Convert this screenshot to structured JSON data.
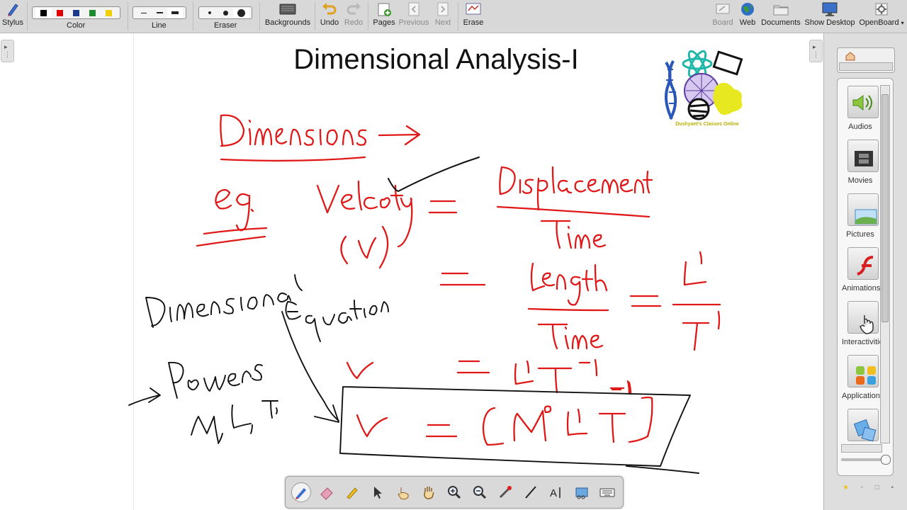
{
  "toolbar": {
    "stylus": "Stylus",
    "color": "Color",
    "line": "Line",
    "eraser": "Eraser",
    "backgrounds": "Backgrounds",
    "undo": "Undo",
    "redo": "Redo",
    "pages": "Pages",
    "previous": "Previous",
    "next": "Next",
    "erase": "Erase",
    "board": "Board",
    "web": "Web",
    "documents": "Documents",
    "show_desktop": "Show Desktop",
    "openboard": "OpenBoard"
  },
  "colors": {
    "swatches": [
      "#000000",
      "#e00000",
      "#1a3b8c",
      "#1e8a2e",
      "#f0d000"
    ],
    "ink_red": "#e01818",
    "ink_black": "#111111"
  },
  "board": {
    "title": "Dimensional Analysis-I",
    "logo_caption": "Dushyant's Classes Online"
  },
  "library": {
    "items": [
      {
        "label": "Audios"
      },
      {
        "label": "Movies"
      },
      {
        "label": "Pictures"
      },
      {
        "label": "Animations"
      },
      {
        "label": "Interactivities"
      },
      {
        "label": "Applications"
      },
      {
        "label": ""
      }
    ]
  }
}
